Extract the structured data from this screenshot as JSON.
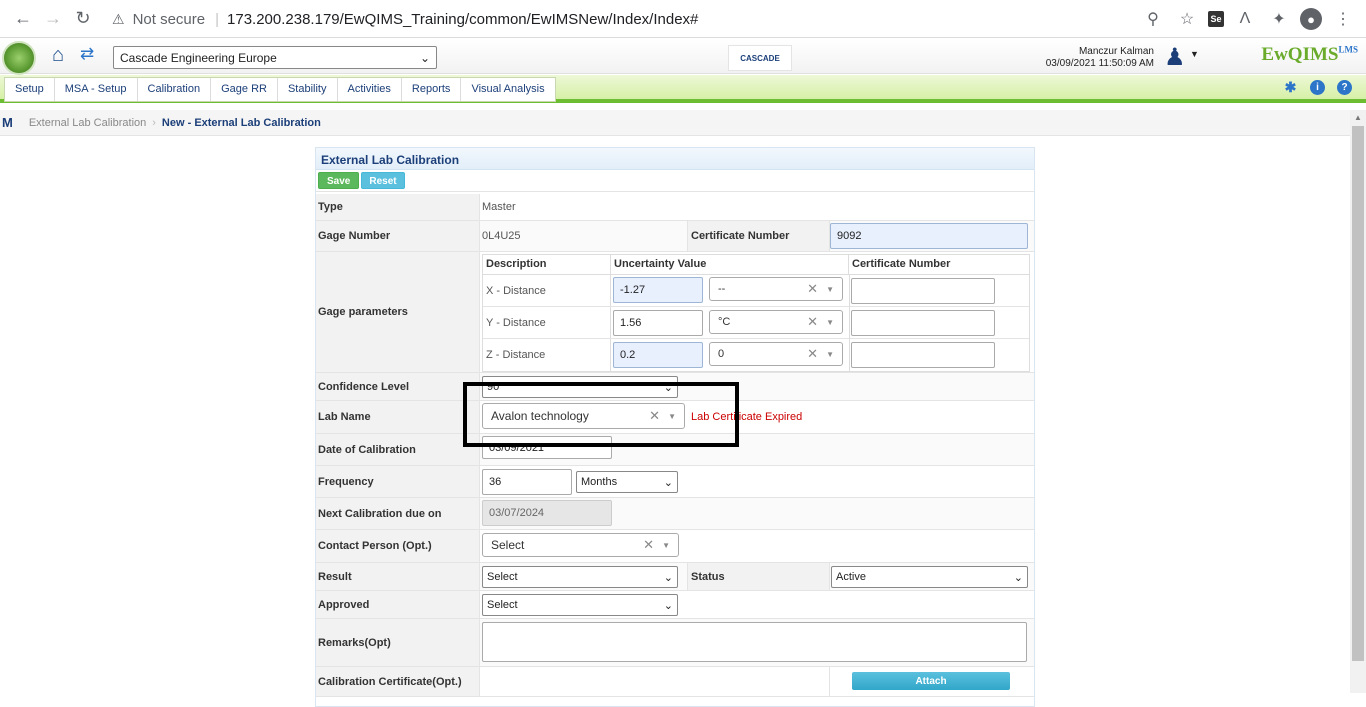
{
  "browser": {
    "security_label": "Not secure",
    "url": "173.200.238.179/EwQIMS_Training/common/EwIMSNew/Index/Index#",
    "se_label": "Se"
  },
  "header": {
    "site": "Cascade Engineering Europe",
    "cascade_logo": "CASCADE",
    "user_name": "Manczur Kalman",
    "datetime": "03/09/2021 11:50:09 AM",
    "brand": "EwQIMS",
    "brand_sup": "LMS"
  },
  "menu": {
    "items": [
      {
        "label": "Setup"
      },
      {
        "label": "MSA - Setup"
      },
      {
        "label": "Calibration"
      },
      {
        "label": "Gage RR"
      },
      {
        "label": "Stability"
      },
      {
        "label": "Activities"
      },
      {
        "label": "Reports"
      },
      {
        "label": "Visual Analysis"
      }
    ]
  },
  "breadcrumb": {
    "root": "M",
    "parent": "External Lab Calibration",
    "current": "New - External Lab Calibration"
  },
  "form": {
    "title": "External Lab Calibration",
    "save_label": "Save",
    "reset_label": "Reset",
    "type_label": "Type",
    "type_value": "Master",
    "gage_number_label": "Gage Number",
    "gage_number_value": "0L4U25",
    "certificate_number_label": "Certificate Number",
    "certificate_number_value": "9092",
    "gage_parameters_label": "Gage parameters",
    "params_headers": {
      "description": "Description",
      "uncertainty": "Uncertainty Value",
      "certificate": "Certificate Number"
    },
    "params": [
      {
        "description": "X - Distance",
        "value": "-1.27",
        "unit": "--",
        "certificate": ""
      },
      {
        "description": "Y - Distance",
        "value": "1.56",
        "unit": "°C",
        "certificate": ""
      },
      {
        "description": "Z - Distance",
        "value": "0.2",
        "unit": "0",
        "certificate": ""
      }
    ],
    "confidence_label": "Confidence Level",
    "confidence_value": "90",
    "lab_name_label": "Lab Name",
    "lab_name_value": "Avalon technology",
    "lab_error": "Lab Certificate Expired",
    "date_label": "Date of Calibration",
    "date_value": "03/09/2021",
    "frequency_label": "Frequency",
    "frequency_value": "36",
    "frequency_unit": "Months",
    "next_due_label": "Next Calibration due on",
    "next_due_value": "03/07/2024",
    "contact_label": "Contact Person (Opt.)",
    "contact_value": "Select",
    "result_label": "Result",
    "result_value": "Select",
    "status_label": "Status",
    "status_value": "Active",
    "approved_label": "Approved",
    "approved_value": "Select",
    "remarks_label": "Remarks(Opt)",
    "cert_label": "Calibration Certificate(Opt.)",
    "attach_label": "Attach"
  }
}
